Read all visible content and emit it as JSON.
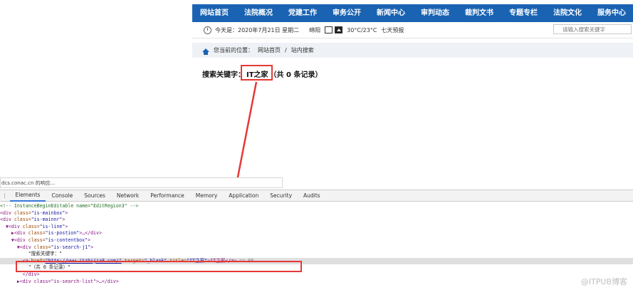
{
  "nav": {
    "items": [
      "网站首页",
      "法院概况",
      "党建工作",
      "审务公开",
      "新闻中心",
      "审判动态",
      "裁判文书",
      "专题专栏",
      "法院文化",
      "服务中心"
    ],
    "bg": "#1a63b3"
  },
  "info": {
    "date": "今天是：2020年7月21日 星期二",
    "city": "绵阳",
    "temp": "30°C/23°C",
    "forecast": "七天预报",
    "search_placeholder": "请输入搜索关键字"
  },
  "breadcrumb": {
    "prefix": "您当前的位置：",
    "home": "网站首页",
    "sep": "/",
    "current": "站内搜索"
  },
  "result": {
    "label": "搜索关键字：",
    "keyword": "IT之家",
    "count": "（共 0 条记录）"
  },
  "devtools": {
    "url": "dcs.conac.cn 的响应...",
    "tabs": [
      "Elements",
      "Console",
      "Sources",
      "Network",
      "Performance",
      "Memory",
      "Application",
      "Security",
      "Audits"
    ]
  },
  "code": {
    "l1": "<!-- InstanceBeginEditable name=\"EditRegion3\" -->",
    "l2_tag": "<div",
    "l2_attr": " class=",
    "l2_val": "\"is-mainbox\"",
    "l2_end": ">",
    "l3_tag": "<div",
    "l3_attr": " class=",
    "l3_val": "\"is-mainnr\"",
    "l3_end": ">",
    "l4_tag": "▼<div",
    "l4_attr": " class=",
    "l4_val": "\"is-line\"",
    "l4_end": ">",
    "l5_tag": "▶<div",
    "l5_attr": " class=",
    "l5_val": "\"is-postion\"",
    "l5_end": ">…</div>",
    "l6_tag": "▼<div",
    "l6_attr": " class=",
    "l6_val": "\"is-contentbox\"",
    "l6_end": ">",
    "l7_tag": "▼<div",
    "l7_attr": " class=",
    "l7_val": "\"is-search-j1\"",
    "l7_end": ">",
    "l8": "\"搜索关键字：\"",
    "l9_a": "<a",
    "l9_href": " href=",
    "l9_url": "\"http://www.itzhijia8.com/\"",
    "l9_target": " target=",
    "l9_tval": "\"_blank\"",
    "l9_title": " title=",
    "l9_titv": "\"IT之家\"",
    "l9_text": ">IT之家</a>",
    "l9_tail": " == $0",
    "l10": "\"（共 0 条记录）\"",
    "l11": "</div>",
    "l12": "▶<div class=\"is-search-list\">…</div>"
  },
  "watermark": "@ITPUB博客"
}
